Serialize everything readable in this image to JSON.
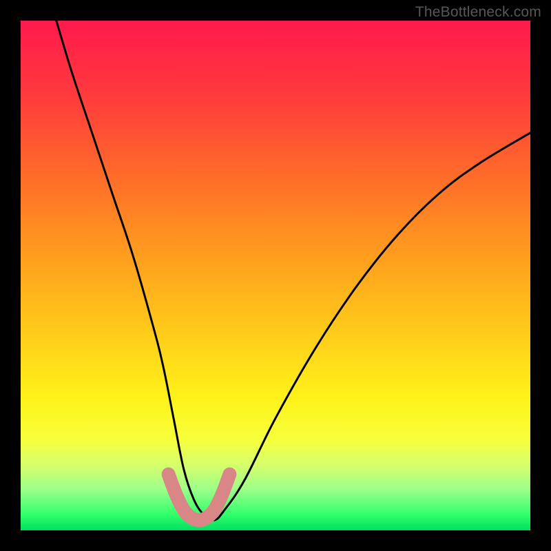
{
  "watermark": "TheBottleneck.com",
  "chart_data": {
    "type": "line",
    "title": "",
    "xlabel": "",
    "ylabel": "",
    "xlim": [
      0,
      100
    ],
    "ylim": [
      0,
      100
    ],
    "grid": false,
    "legend": false,
    "series": [
      {
        "name": "bottleneck-curve",
        "color": "#000000",
        "x": [
          7,
          10,
          14,
          18,
          22,
          26,
          28,
          30,
          32,
          34,
          36,
          38,
          40,
          44,
          50,
          58,
          66,
          74,
          82,
          90,
          100
        ],
        "values": [
          100,
          90,
          78,
          66,
          54,
          40,
          32,
          22,
          12,
          6,
          3,
          2,
          4,
          10,
          22,
          36,
          48,
          58,
          66,
          72,
          78
        ]
      },
      {
        "name": "highlight-band",
        "color": "#d98686",
        "x": [
          29,
          30.5,
          32,
          33.5,
          35,
          36.5,
          38,
          39.5,
          41
        ],
        "values": [
          11,
          7,
          4,
          2.5,
          2,
          2.5,
          4,
          7,
          11
        ]
      }
    ],
    "background_gradient": {
      "top": "#ff1a4d",
      "middle": "#fff21a",
      "bottom": "#00e060"
    }
  }
}
